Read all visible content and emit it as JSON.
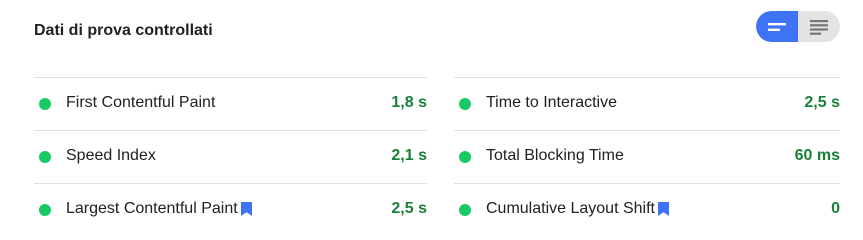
{
  "header": {
    "title": "Dati di prova controllati"
  },
  "colors": {
    "pass": "#18c964",
    "value_text": "#188038",
    "accent": "#3f73f5",
    "bookmark": "#3f73f5"
  },
  "toggle": {
    "left_icon": "list-compact-icon",
    "right_icon": "list-expanded-icon",
    "active": "left"
  },
  "metrics": {
    "left": [
      {
        "label": "First Contentful Paint",
        "value": "1,8 s",
        "status": "pass",
        "bookmark": false
      },
      {
        "label": "Speed Index",
        "value": "2,1 s",
        "status": "pass",
        "bookmark": false
      },
      {
        "label": "Largest Contentful Paint",
        "value": "2,5 s",
        "status": "pass",
        "bookmark": true
      }
    ],
    "right": [
      {
        "label": "Time to Interactive",
        "value": "2,5 s",
        "status": "pass",
        "bookmark": false
      },
      {
        "label": "Total Blocking Time",
        "value": "60 ms",
        "status": "pass",
        "bookmark": false
      },
      {
        "label": "Cumulative Layout Shift",
        "value": "0",
        "status": "pass",
        "bookmark": true
      }
    ]
  }
}
